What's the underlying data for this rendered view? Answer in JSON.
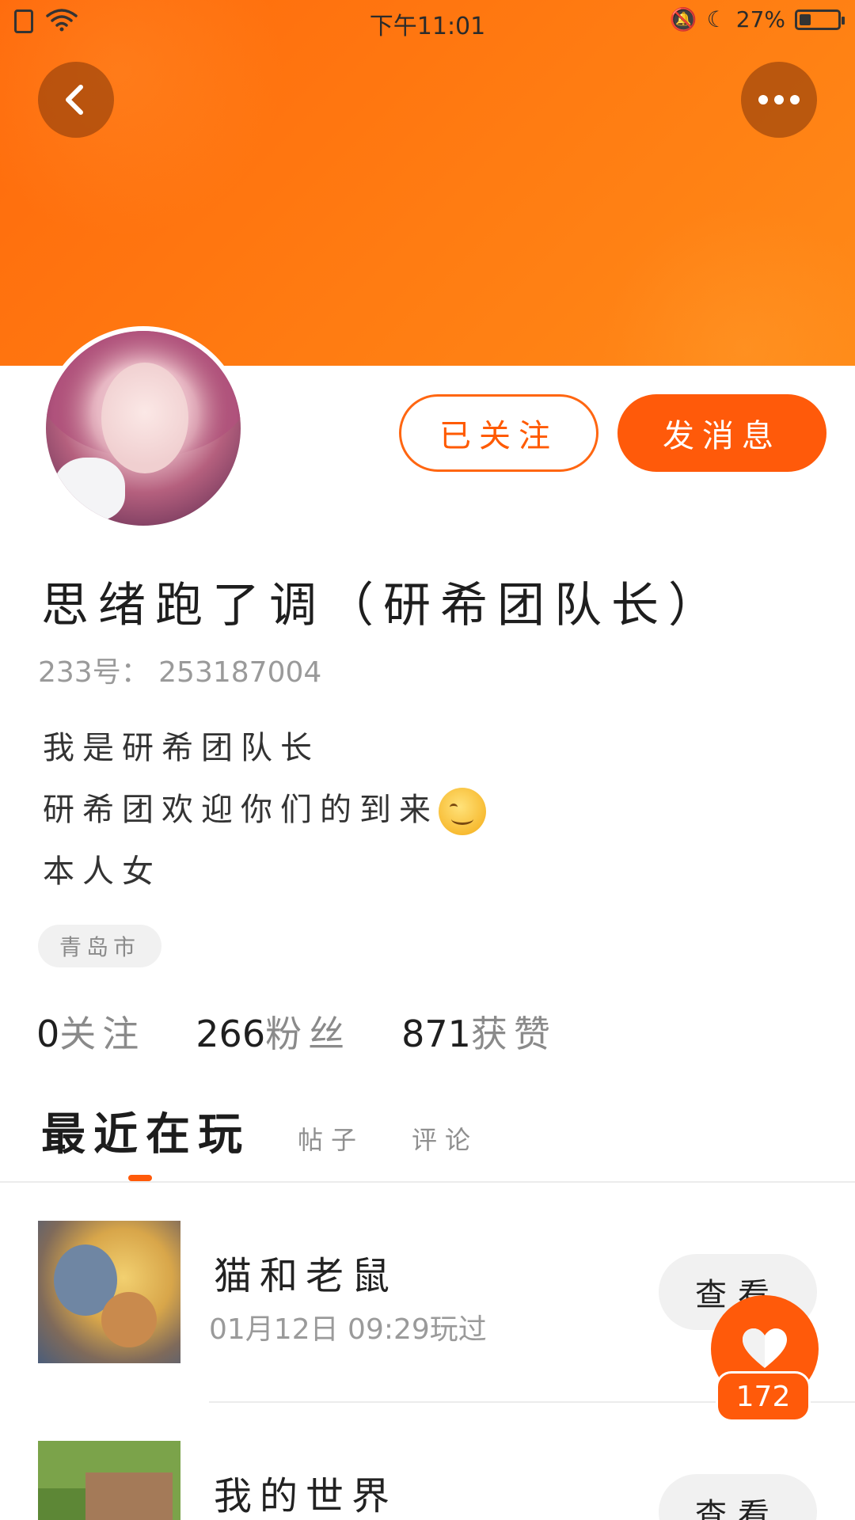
{
  "status_bar": {
    "time": "下午11:01",
    "battery": "27%"
  },
  "header": {
    "back_icon": "chevron-left-icon",
    "more_icon": "more-dots-icon",
    "accent_color": "#ff6a0c"
  },
  "profile": {
    "follow_button": "已关注",
    "message_button": "发消息",
    "name": "思绪跑了调（研希团队长）",
    "uid": "233号： 253187004",
    "bio_lines": [
      "我是研希团队长",
      "研希团欢迎你们的到来",
      "本人女"
    ],
    "location": "青岛市",
    "stats": [
      {
        "value": "0",
        "label": "关注"
      },
      {
        "value": "266",
        "label": "粉丝"
      },
      {
        "value": "871",
        "label": "获赞"
      }
    ]
  },
  "tabs": [
    {
      "label": "最近在玩",
      "active": true
    },
    {
      "label": "帖子",
      "active": false
    },
    {
      "label": "评论",
      "active": false
    }
  ],
  "games": [
    {
      "title": "猫和老鼠",
      "last_played": "01月12日 09:29玩过",
      "button": "查看"
    },
    {
      "title": "我的世界",
      "last_played": "",
      "button": "查看"
    }
  ],
  "float_like": {
    "icon": "heart-icon",
    "count": "172"
  }
}
